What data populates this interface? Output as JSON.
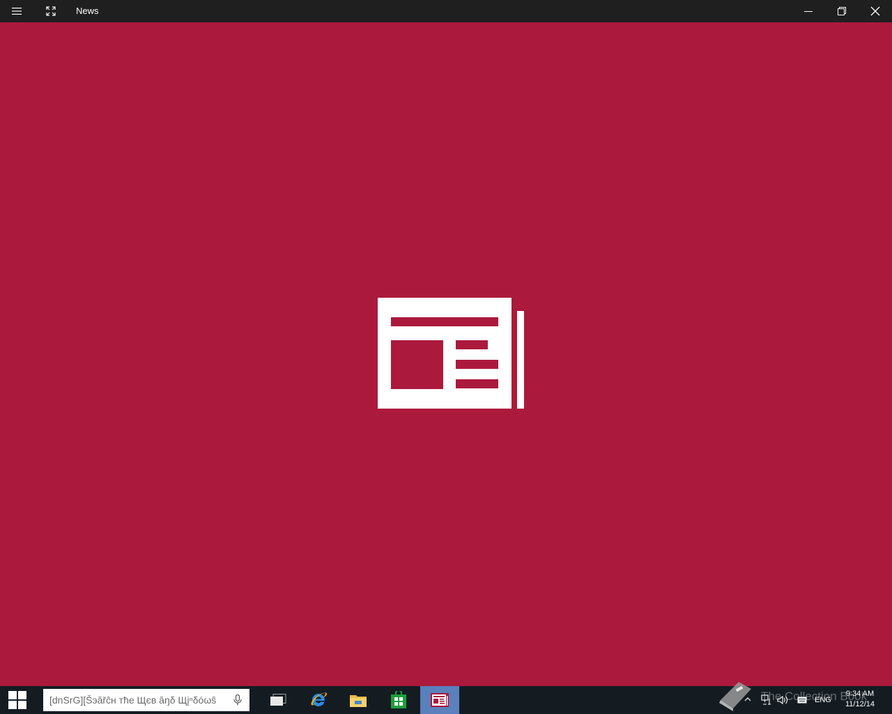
{
  "window": {
    "title": "News"
  },
  "taskbar": {
    "search_placeholder": "[dnSrG][Šэăřĉн тħe Щєв ăŋδ Щįⁿδóωŝ",
    "apps": [
      {
        "name": "task-view",
        "icon": "task-view-icon"
      },
      {
        "name": "internet-explorer",
        "icon": "internet-explorer-icon"
      },
      {
        "name": "file-explorer",
        "icon": "folder-icon"
      },
      {
        "name": "store",
        "icon": "store-icon"
      },
      {
        "name": "news",
        "icon": "news-icon",
        "active": true
      }
    ],
    "tray": {
      "language": "ENG",
      "time": "9:34 AM",
      "date": "11/12/14"
    }
  },
  "watermark": {
    "text": "The Collection Book"
  },
  "colors": {
    "accent": "#ab193c",
    "titlebar": "#1f1f1f",
    "taskbar": "#141c22",
    "active_app": "#5a80bd"
  }
}
